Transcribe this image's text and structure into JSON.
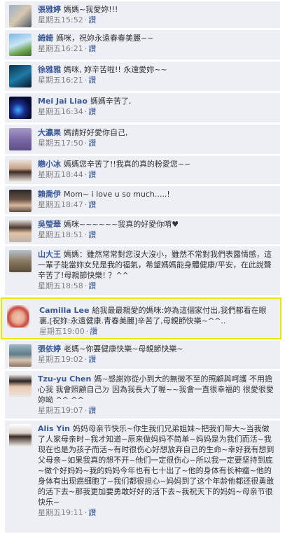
{
  "sep": "·",
  "comments": [
    {
      "name": "張雅婷",
      "text": "媽媽~我愛妳!!!",
      "time": "星期五15:52",
      "like": "讚"
    },
    {
      "name": "綺綺",
      "text": "媽咪，祝妳永遠春春美麗~~",
      "time": "星期五16:21",
      "like": "讚"
    },
    {
      "name": "徐雅雅",
      "text": "媽咪, 妳辛苦啦!! 永遠愛妳~~",
      "time": "星期五16:21",
      "like": "讚"
    },
    {
      "name": "Mei Jai Liao",
      "text": "媽媽辛苦了,",
      "time": "星期五16:34",
      "like": "讚"
    },
    {
      "name": "大瀛果",
      "text": "媽請好好愛你自己,",
      "time": "星期五17:50",
      "like": "讚"
    },
    {
      "name": "戀小冰",
      "text": "媽媽您辛苦了!!我真的真的粉愛您~~",
      "time": "星期五18:44",
      "like": "讚"
    },
    {
      "name": "賴喬伊",
      "text": "Mom~ i love u so much.....!",
      "time": "星期五18:47",
      "like": "讚"
    },
    {
      "name": "吳瑩華",
      "text": "媽咪~~~~~~我真的好愛你唷♥",
      "time": "星期五18:51",
      "like": "讚"
    },
    {
      "name": "山大王",
      "text": "媽媽：雖然常常對您沒大沒小，雖然不常對我們表露情感，這一輩子能當妳女兒是我的福氣，希望媽媽能身體健康/平安，在此說聲辛苦了!母親節快樂! ？^^",
      "time": "星期五18:58",
      "like": "讚"
    },
    {
      "name": "Camilla Lee",
      "text": "給我最最親愛的媽咪:妳為這個家付出,我們都看在眼裏,[祝妳:永遠健康.青春美麗]辛苦了,母親節快樂~^^..",
      "time": "星期五19:00",
      "like": "讚"
    },
    {
      "name": "張依婷",
      "text": "老媽~你要健康快樂~母親節快樂~",
      "time": "星期五19:02",
      "like": "讚"
    },
    {
      "name": "Tzu-yu Chen",
      "text": "媽~感謝妳從小到大的無微不至的照顧與呵護 不用擔心我 我會照顧自己ㄉ 因為我長大了喔~~我會一直很幸福的 很愛很愛妳呦 ^^ ^^",
      "time": "星期五19:07",
      "like": "讚"
    },
    {
      "name": "Alis Yin",
      "text": "妈妈母亲节快乐~你生我们兄弟姐妹~把我们带大~当我做了人家母亲时~我才知道~原来做妈妈不简单~妈妈是为我们而活~我现在也是为孩子而活~有时很伤心好想放弃自己的生命~幸好我有想到父母亲~如果我真的想不开~他们一定很伤心~所以我一定要坚持到底~做个好妈妈~我的妈妈今年也有七十出了~他的身体有长种瘤~他的身体有出现癌细胞了~我们都很担心~妈妈到了这个年龄他都还很勇敢的活下去~那我更加要勇敢好好的活下去~我祝天下的妈妈~母亲节很快乐~",
      "time": "星期五19:11",
      "like": "讚"
    }
  ]
}
